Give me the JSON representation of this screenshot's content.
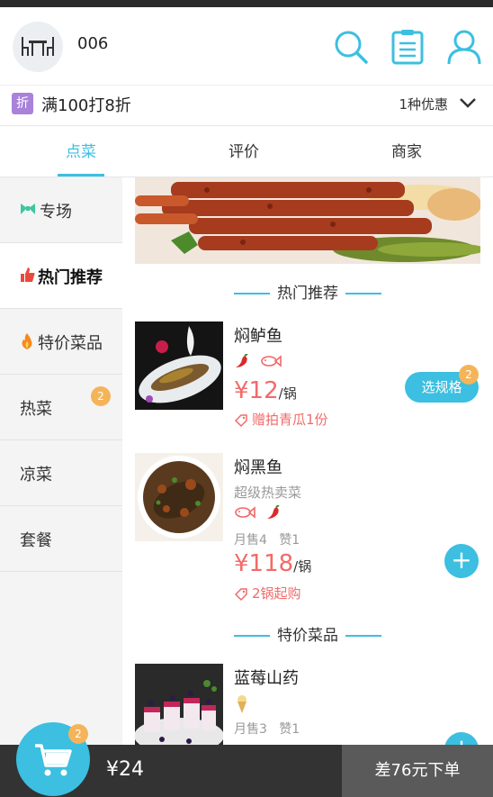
{
  "header": {
    "table_number": "006"
  },
  "promo": {
    "badge": "折",
    "text": "满100打8折",
    "count": "1种优惠"
  },
  "tabs": [
    {
      "label": "点菜"
    },
    {
      "label": "评价"
    },
    {
      "label": "商家"
    }
  ],
  "sidebar": {
    "items": [
      {
        "label": "专场"
      },
      {
        "label": "热门推荐",
        "active": true
      },
      {
        "label": "特价菜品"
      },
      {
        "label": "热菜",
        "badge": "2"
      },
      {
        "label": "凉菜"
      },
      {
        "label": "套餐"
      }
    ]
  },
  "sections": {
    "hot": "热门推荐",
    "special": "特价菜品"
  },
  "dishes": [
    {
      "name": "焖鲈鱼",
      "price": "¥12",
      "unit": "/锅",
      "tag": "赠拍青瓜1份",
      "spec_button": "选规格",
      "spec_badge": "2"
    },
    {
      "name": "焖黑鱼",
      "subtitle": "超级热卖菜",
      "sold": "月售4",
      "likes": "赞1",
      "price": "¥118",
      "unit": "/锅",
      "tag": "2锅起购"
    },
    {
      "name": "蓝莓山药",
      "sold": "月售3",
      "likes": "赞1"
    }
  ],
  "cart": {
    "badge": "2",
    "total": "¥24",
    "checkout": "差76元下单"
  },
  "colors": {
    "accent": "#3cbfe0",
    "price": "#f26a6a",
    "badge": "#f5b45a",
    "promo_badge": "#a982d9"
  }
}
